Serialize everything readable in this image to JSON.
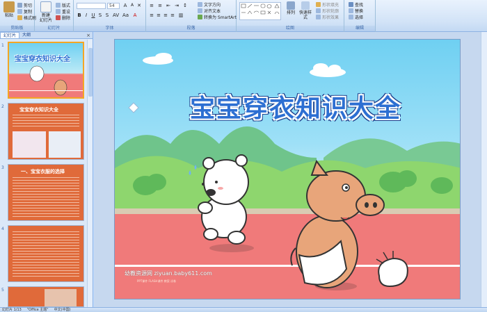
{
  "ribbon": {
    "groups": {
      "clipboard": "剪贴板",
      "slides": "幻灯片",
      "font": "字体",
      "paragraph": "段落",
      "drawing": "绘图",
      "editing": "编辑"
    },
    "paste": "粘贴",
    "cut": "剪切",
    "copy": "复制",
    "format_painter": "格式刷",
    "new_slide": "新建\n幻灯片",
    "layout": "版式",
    "reset": "重设",
    "delete": "删除",
    "font_size": "54",
    "text_direction": "文字方向",
    "align_text": "对齐文本",
    "smartart": "转换为 SmartArt",
    "arrange": "排列",
    "quick_styles": "快速样式",
    "shape_fill": "形状填充",
    "shape_outline": "形状轮廓",
    "shape_effects": "形状效果",
    "find": "查找",
    "replace": "替换",
    "select": "选择"
  },
  "left_panel": {
    "tabs": [
      "幻灯片",
      "大纲"
    ],
    "thumbnails": [
      {
        "num": "1",
        "title": "宝宝穿衣知识大全"
      },
      {
        "num": "2",
        "title": "宝宝穿衣知识大全"
      },
      {
        "num": "3",
        "title": "一、宝宝衣服的选择"
      },
      {
        "num": "4",
        "title": ""
      },
      {
        "num": "5",
        "title": ""
      }
    ]
  },
  "slide": {
    "title": "宝宝穿衣知识大全",
    "watermark": "幼教资源网 ziyuan.baby611.com",
    "watermark_sub": "PPT课件 FLASH课件 教案 试卷"
  },
  "status": {
    "slide_info": "幻灯片 1/13",
    "theme": "\"Office 主题\"",
    "language": "中文(中国)"
  },
  "colors": {
    "accent": "#2d6fd2",
    "selection": "#f5a623",
    "track": "#f07a7a"
  }
}
